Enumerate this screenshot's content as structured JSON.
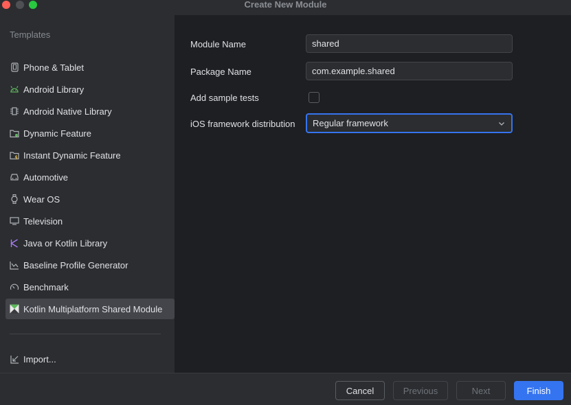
{
  "window": {
    "title": "Create New Module"
  },
  "sidebar": {
    "heading": "Templates",
    "items": [
      {
        "label": "Phone & Tablet",
        "icon": "phone-tablet-icon"
      },
      {
        "label": "Android Library",
        "icon": "android-icon"
      },
      {
        "label": "Android Native Library",
        "icon": "native-library-icon"
      },
      {
        "label": "Dynamic Feature",
        "icon": "dynamic-feature-folder-icon"
      },
      {
        "label": "Instant Dynamic Feature",
        "icon": "instant-feature-folder-icon"
      },
      {
        "label": "Automotive",
        "icon": "car-icon"
      },
      {
        "label": "Wear OS",
        "icon": "watch-icon"
      },
      {
        "label": "Television",
        "icon": "tv-icon"
      },
      {
        "label": "Java or Kotlin Library",
        "icon": "kotlin-icon"
      },
      {
        "label": "Baseline Profile Generator",
        "icon": "chart-icon"
      },
      {
        "label": "Benchmark",
        "icon": "gauge-icon"
      },
      {
        "label": "Kotlin Multiplatform Shared Module",
        "icon": "kmp-icon",
        "selected": true
      }
    ],
    "import_label": "Import..."
  },
  "form": {
    "module_name_label": "Module Name",
    "module_name_value": "shared",
    "package_name_label": "Package Name",
    "package_name_value": "com.example.shared",
    "sample_tests_label": "Add sample tests",
    "sample_tests_checked": false,
    "ios_dist_label": "iOS framework distribution",
    "ios_dist_value": "Regular framework"
  },
  "footer": {
    "cancel_label": "Cancel",
    "previous_label": "Previous",
    "next_label": "Next",
    "finish_label": "Finish"
  },
  "colors": {
    "accent": "#3574f0",
    "background": "#1e1f22",
    "panel": "#2b2d30",
    "selected": "#43454a"
  }
}
